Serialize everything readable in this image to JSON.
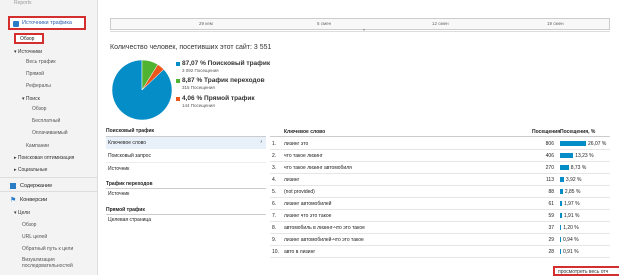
{
  "colors": {
    "accent": "#058dc7",
    "green": "#50b432",
    "orange": "#ed561b",
    "highlight": "#d32f2f",
    "lightblue": "#e8f0fa"
  },
  "top_fragment": "Reports",
  "sidebar": {
    "traffic_sources": "Источники трафика",
    "overview": "Обзор",
    "sources_header": "Источники",
    "sources": [
      "Весь трафик",
      "Прямой",
      "Рефералы"
    ],
    "search_header": "Поиск",
    "search_items": [
      "Обзор",
      "Бесплатный",
      "Оплачиваемый"
    ],
    "campaigns": "Кампании",
    "search_opt": "Поисковая оптимизация",
    "social": "Социальные",
    "content": "Содержание",
    "conversions": "Конверсии",
    "goals_header": "Цели",
    "goals": [
      "Обзор",
      "URL целей",
      "Обратный путь к цели",
      "Визуализация последовательностей"
    ]
  },
  "timeline": {
    "labels": [
      "29 кем",
      "5 смен",
      "12 смен",
      "19 смен"
    ]
  },
  "visits": {
    "label": "Количество человек, посетивших этот сайт:",
    "value": "3 551"
  },
  "chart_data": {
    "type": "pie",
    "categories": [
      "Поисковый трафик",
      "Трафик переходов",
      "Прямой трафик"
    ],
    "values": [
      87.07,
      8.87,
      4.06
    ],
    "colors": [
      "#058dc7",
      "#50b432",
      "#ed561b"
    ]
  },
  "legend": [
    {
      "pct": "87,07 %",
      "name": "Поисковый трафик",
      "sub": "3 092 Посещения",
      "color": "#058dc7"
    },
    {
      "pct": "8,87 %",
      "name": "Трафик переходов",
      "sub": "315 Посещения",
      "color": "#50b432"
    },
    {
      "pct": "4,06 %",
      "name": "Прямой трафик",
      "sub": "144 Посещения",
      "color": "#ed561b"
    }
  ],
  "left_menu": {
    "search_header": "Поисковый трафик",
    "search_items": [
      "Ключевое слово",
      "Поисковый запрос",
      "Источник"
    ],
    "referral_header": "Трафик переходов",
    "referral_items": [
      "Источник"
    ],
    "direct_header": "Прямой трафик",
    "direct_items": [
      "Целевая страница"
    ]
  },
  "table": {
    "col_keyword": "Ключевое слово",
    "col_visits": "Посещения",
    "col_pct": "Посещения, %",
    "rows": [
      {
        "n": "1.",
        "kw": "лизинг это",
        "v": "806",
        "p": "26,07 %",
        "f": 0.2607
      },
      {
        "n": "2.",
        "kw": "что такое лизинг",
        "v": "406",
        "p": "13,23 %",
        "f": 0.1323
      },
      {
        "n": "3.",
        "kw": "что такое лизинг автомобиля",
        "v": "270",
        "p": "8,73 %",
        "f": 0.0873
      },
      {
        "n": "4.",
        "kw": "лизинг",
        "v": "113",
        "p": "3,92 %",
        "f": 0.0392
      },
      {
        "n": "5.",
        "kw": "(not provided)",
        "v": "88",
        "p": "2,85 %",
        "f": 0.0285
      },
      {
        "n": "6.",
        "kw": "лизинг автомобилей",
        "v": "61",
        "p": "1,97 %",
        "f": 0.0197
      },
      {
        "n": "7.",
        "kw": "лизинг что это такое",
        "v": "59",
        "p": "1,91 %",
        "f": 0.0191
      },
      {
        "n": "8.",
        "kw": "автомобиль в лизинг-что это такое",
        "v": "37",
        "p": "1,20 %",
        "f": 0.012
      },
      {
        "n": "9.",
        "kw": "лизинг автомобилей-что это такое",
        "v": "29",
        "p": "0,94 %",
        "f": 0.0094
      },
      {
        "n": "10.",
        "kw": "авто в лизинг",
        "v": "28",
        "p": "0,91 %",
        "f": 0.0091
      }
    ]
  },
  "view_all": "просмотреть весь отч"
}
